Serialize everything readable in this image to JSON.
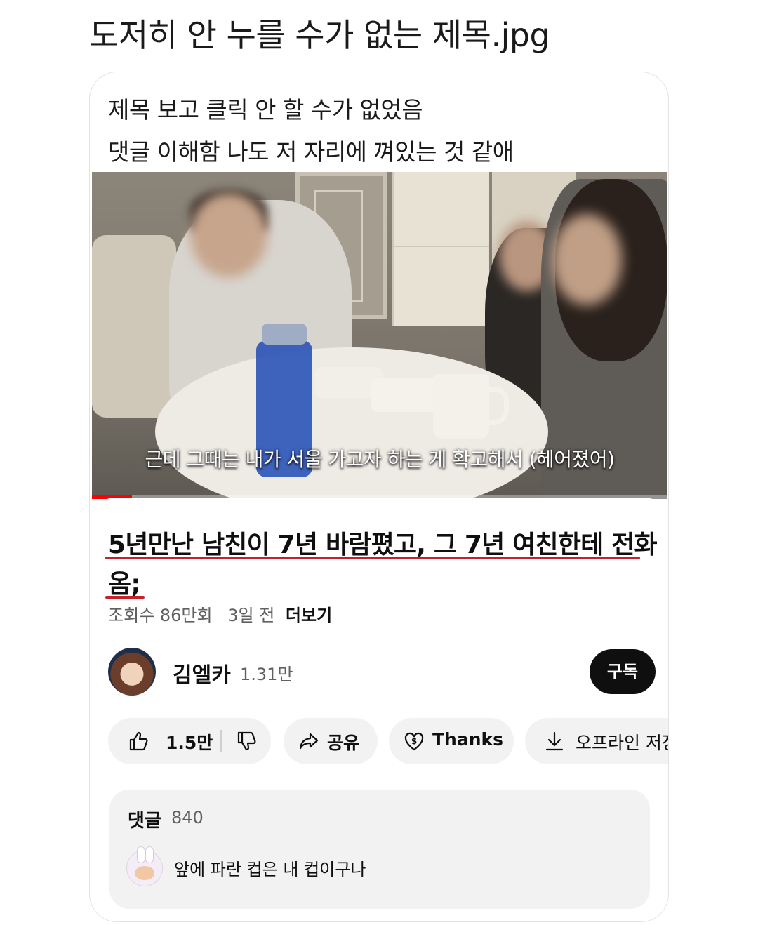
{
  "post": {
    "title": "도저히 안 누를 수가 없는 제목.jpg",
    "caption_line1": "제목 보고 클릭 안 할 수가 없었음",
    "caption_line2": "댓글 이해함 나도 저 자리에 껴있는 것 같애"
  },
  "video": {
    "subtitle": "근데 그때는 내가 서울 가고자 하는 게 확고해서 (헤어졌어)",
    "progress_fraction": 0.07,
    "progress_color": "#ff0000"
  },
  "info": {
    "title_line1": "5년만난 남친이 7년 바람폈고, 그 7년 여친한테 전화",
    "title_line2": "옴;",
    "views": "조회수 86만회",
    "age": "3일 전",
    "more": "더보기",
    "underline_color": "#c8202a"
  },
  "channel": {
    "name": "김엘카",
    "subscribers": "1.31만",
    "subscribe_label": "구독"
  },
  "actions": {
    "like_count": "1.5만",
    "share_label": "공유",
    "thanks_label": "Thanks",
    "offline_label": "오프라인 저장"
  },
  "comments": {
    "header": "댓글",
    "count": "840",
    "top_comment": "앞에 파란 컵은 내 컵이구나"
  }
}
